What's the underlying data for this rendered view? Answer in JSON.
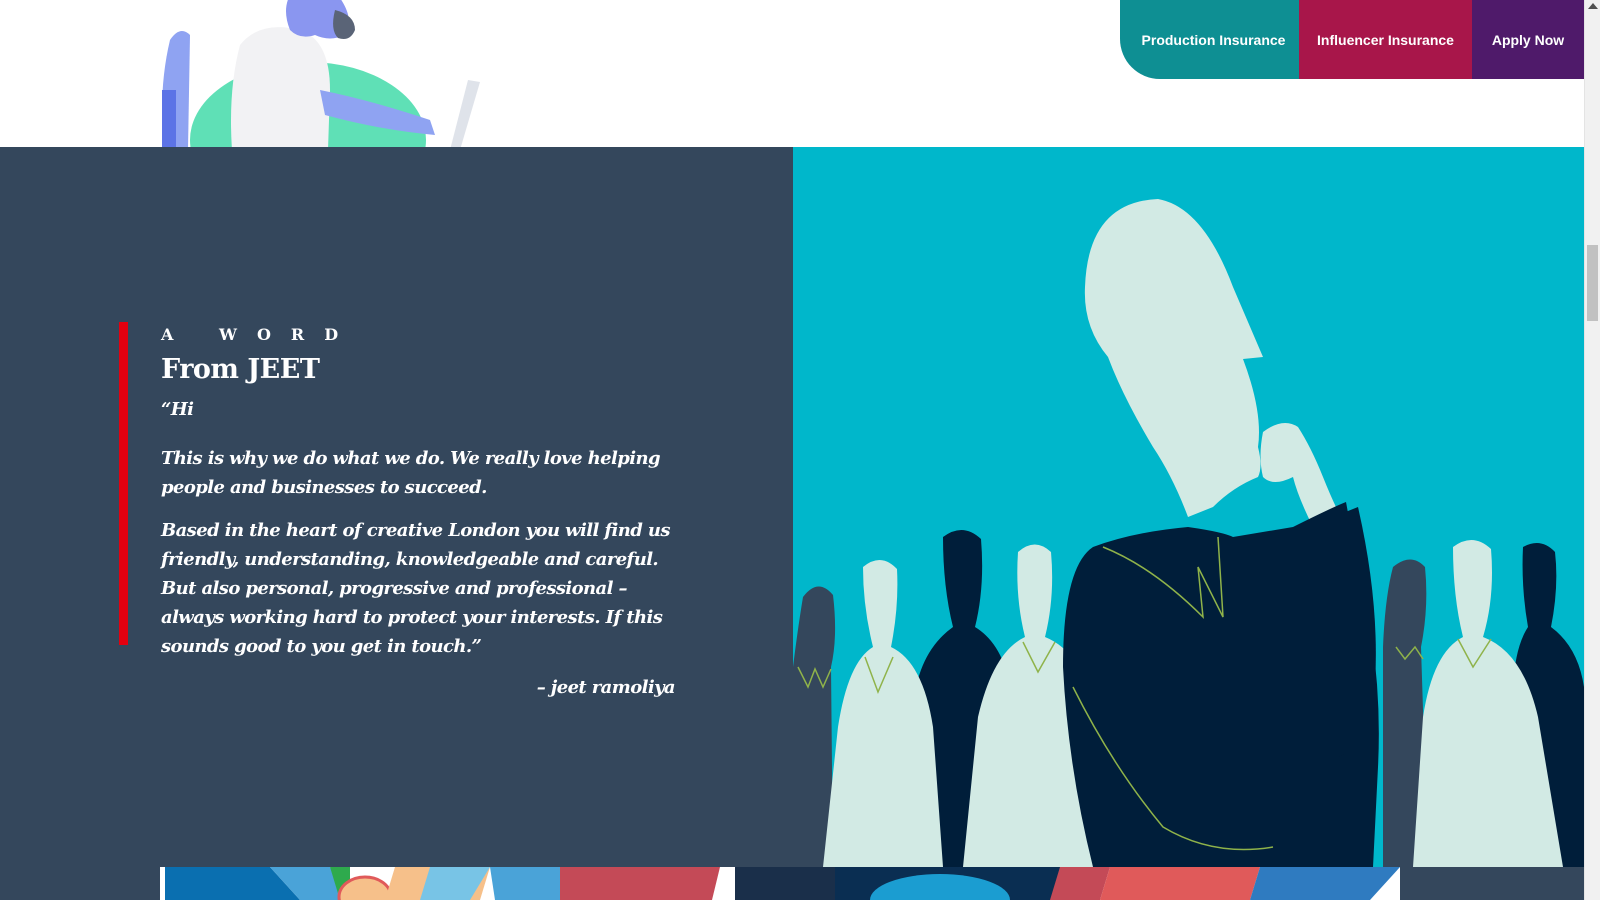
{
  "nav": {
    "production_label": "Production Insurance",
    "influencer_label": "Influencer Insurance",
    "apply_label": "Apply Now"
  },
  "quote": {
    "eyebrow": "A WORD",
    "heading": "From JEET",
    "greeting": "“Hi",
    "paragraph_1": "This is why we do what we do. We really love helping people and businesses to succeed.",
    "paragraph_2": "Based in the heart of creative London you will find us friendly, understanding, knowledgeable and careful. But also personal, progressive and professional – always working hard to protect your interests. If this sounds good to you get in touch.”",
    "signature": "– jeet ramoliya"
  },
  "colors": {
    "production": "#0e8f93",
    "influencer": "#a8164a",
    "apply": "#4f1a6a",
    "quote_bg": "#34475c",
    "accent_bar": "#e3000f",
    "illustration_bg": "#00b7cb"
  },
  "icons": {
    "top_illustration": "person-at-laptop-illustration",
    "right_illustration": "thinking-man-crowd-illustration",
    "scroll_up": "scroll-up-arrow-icon"
  }
}
